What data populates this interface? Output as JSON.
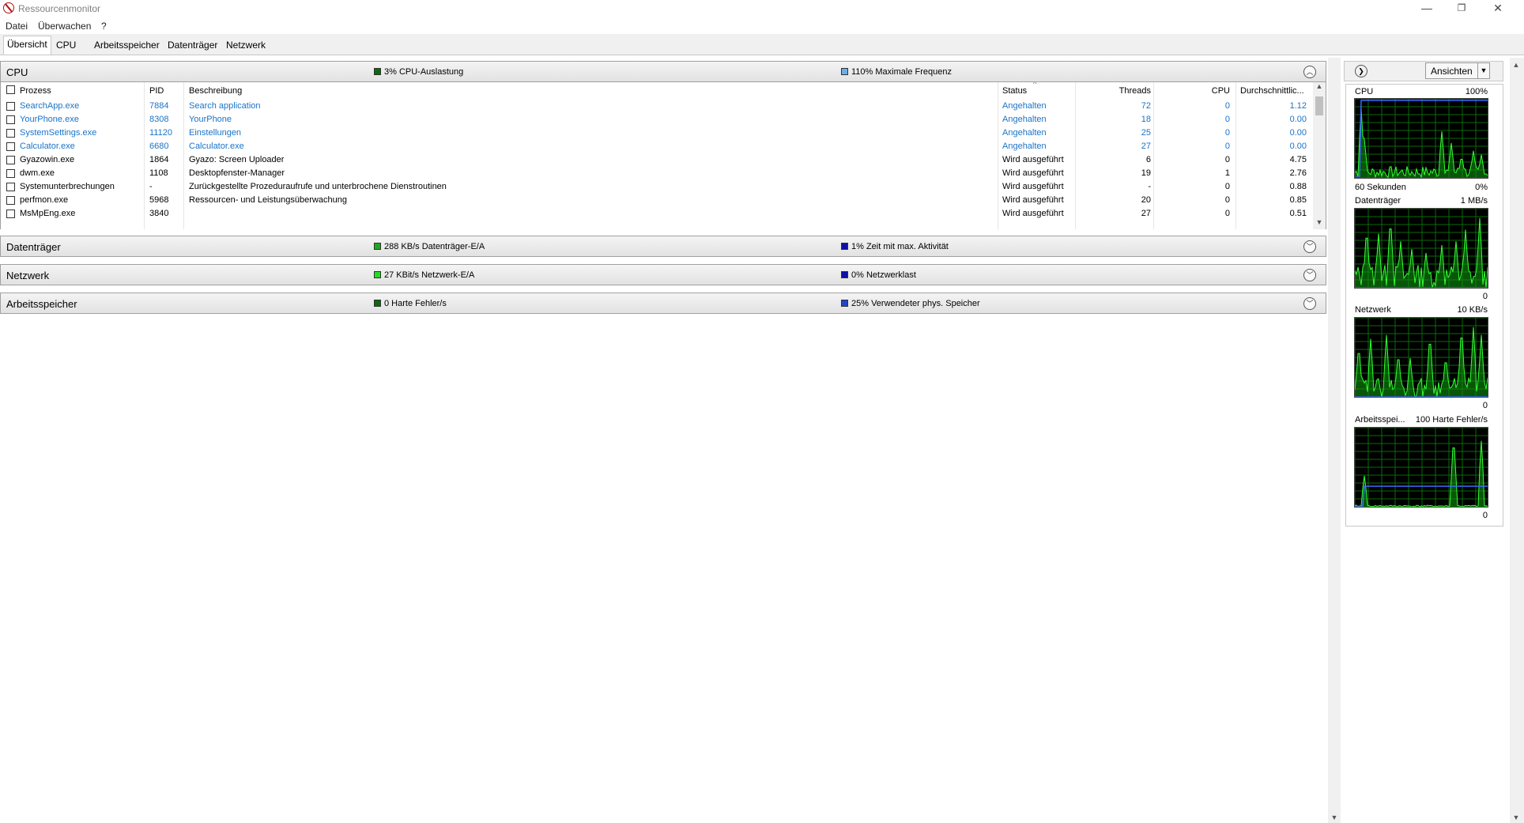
{
  "window": {
    "title": "Ressourcenmonitor",
    "minimize": "—",
    "restore": "❐",
    "close": "✕"
  },
  "menu": [
    "Datei",
    "Überwachen",
    "?"
  ],
  "tabs": [
    "Übersicht",
    "CPU",
    "Arbeitsspeicher",
    "Datenträger",
    "Netzwerk"
  ],
  "sections": {
    "cpu": {
      "title": "CPU",
      "stat1": "3% CPU-Auslastung",
      "stat2": "110% Maximale Frequenz",
      "color1": "#0b6b0b",
      "color2": "#6aaee8"
    },
    "disk": {
      "title": "Datenträger",
      "stat1": "288 KB/s Datenträger-E/A",
      "stat2": "1% Zeit mit max. Aktivität",
      "color1": "#1ea81e",
      "color2": "#1010a8"
    },
    "net": {
      "title": "Netzwerk",
      "stat1": "27 KBit/s Netzwerk-E/A",
      "stat2": "0% Netzwerklast",
      "color1": "#22dd22",
      "color2": "#1010a8"
    },
    "mem": {
      "title": "Arbeitsspeicher",
      "stat1": "0 Harte Fehler/s",
      "stat2": "25% Verwendeter phys. Speicher",
      "color1": "#0b6b0b",
      "color2": "#2244cc"
    }
  },
  "table": {
    "headers": {
      "process": "Prozess",
      "pid": "PID",
      "desc": "Beschreibung",
      "status": "Status",
      "threads": "Threads",
      "cpu": "CPU",
      "avg": "Durchschnittlic..."
    },
    "rows": [
      {
        "process": "SearchApp.exe",
        "pid": "7884",
        "desc": "Search application",
        "status": "Angehalten",
        "threads": "72",
        "cpu": "0",
        "avg": "1.12",
        "suspended": true
      },
      {
        "process": "YourPhone.exe",
        "pid": "8308",
        "desc": "YourPhone",
        "status": "Angehalten",
        "threads": "18",
        "cpu": "0",
        "avg": "0.00",
        "suspended": true
      },
      {
        "process": "SystemSettings.exe",
        "pid": "11120",
        "desc": "Einstellungen",
        "status": "Angehalten",
        "threads": "25",
        "cpu": "0",
        "avg": "0.00",
        "suspended": true
      },
      {
        "process": "Calculator.exe",
        "pid": "6680",
        "desc": "Calculator.exe",
        "status": "Angehalten",
        "threads": "27",
        "cpu": "0",
        "avg": "0.00",
        "suspended": true
      },
      {
        "process": "Gyazowin.exe",
        "pid": "1864",
        "desc": "Gyazo: Screen Uploader",
        "status": "Wird ausgeführt",
        "threads": "6",
        "cpu": "0",
        "avg": "4.75",
        "suspended": false
      },
      {
        "process": "dwm.exe",
        "pid": "1108",
        "desc": "Desktopfenster-Manager",
        "status": "Wird ausgeführt",
        "threads": "19",
        "cpu": "1",
        "avg": "2.76",
        "suspended": false
      },
      {
        "process": "Systemunterbrechungen",
        "pid": "-",
        "desc": "Zurückgestellte Prozeduraufrufe und unterbrochene Dienstroutinen",
        "status": "Wird ausgeführt",
        "threads": "-",
        "cpu": "0",
        "avg": "0.88",
        "suspended": false
      },
      {
        "process": "perfmon.exe",
        "pid": "5968",
        "desc": "Ressourcen- und Leistungsüberwachung",
        "status": "Wird ausgeführt",
        "threads": "20",
        "cpu": "0",
        "avg": "0.85",
        "suspended": false
      },
      {
        "process": "MsMpEng.exe",
        "pid": "3840",
        "desc": "",
        "status": "Wird ausgeführt",
        "threads": "27",
        "cpu": "0",
        "avg": "0.51",
        "suspended": false
      }
    ]
  },
  "rightpane": {
    "views_label": "Ansichten",
    "graphs": [
      {
        "name": "CPU",
        "max": "100%",
        "footer_left": "60 Sekunden",
        "footer_right": "0%"
      },
      {
        "name": "Datenträger",
        "max": "1 MB/s",
        "footer_left": "",
        "footer_right": "0"
      },
      {
        "name": "Netzwerk",
        "max": "10 KB/s",
        "footer_left": "",
        "footer_right": "0"
      },
      {
        "name": "Arbeitsspei...",
        "max": "100 Harte Fehler/s",
        "footer_left": "",
        "footer_right": "0"
      }
    ]
  },
  "icons": {
    "expand": "chevron-down-icon",
    "collapse": "chevron-up-icon",
    "sidebar_toggle": "chevron-right-icon"
  }
}
